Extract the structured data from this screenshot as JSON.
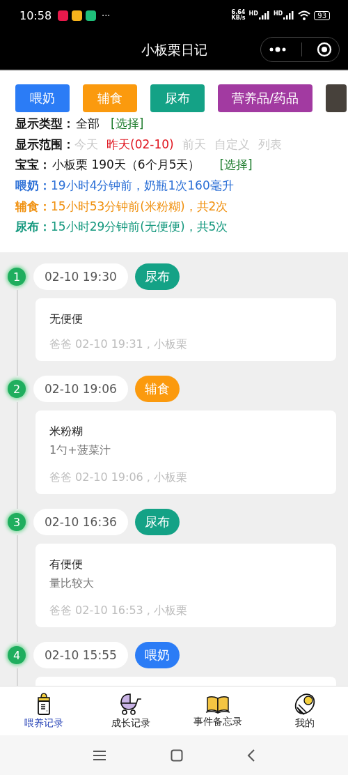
{
  "status_bar": {
    "time": "10:58",
    "more": "···",
    "speed_value": "6.64",
    "speed_unit": "KB/s",
    "sim_labels": [
      "HD",
      "HD"
    ],
    "battery": "93"
  },
  "title_bar": {
    "title": "小板栗日记"
  },
  "categories": [
    {
      "label": "喂奶",
      "color": "#2b7cf6"
    },
    {
      "label": "辅食",
      "color": "#fb9a0e"
    },
    {
      "label": "尿布",
      "color": "#14a286"
    },
    {
      "label": "营养品/药品",
      "color": "#a23aa1"
    },
    {
      "color": "#47413b"
    }
  ],
  "display_type": {
    "label": "显示类型：",
    "value": "全部",
    "action": "[选择]"
  },
  "display_range": {
    "label": "显示范围：",
    "options": [
      {
        "label": "今天",
        "selected": false
      },
      {
        "label": "昨天(02-10)",
        "selected": true
      },
      {
        "label": "前天",
        "selected": false
      },
      {
        "label": "自定义",
        "selected": false
      },
      {
        "label": "列表",
        "selected": false
      }
    ]
  },
  "baby": {
    "label": "宝宝：",
    "value": "小板栗 190天（6个月5天）",
    "action": "[选择]"
  },
  "summaries": [
    {
      "label": "喂奶：",
      "text": "19小时4分钟前，奶瓶1次160毫升",
      "color": "#2b6fd6"
    },
    {
      "label": "辅食：",
      "text": "15小时53分钟前(米粉糊)，共2次",
      "color": "#f0900e"
    },
    {
      "label": "尿布：",
      "text": "15小时29分钟前(无便便)，共5次",
      "color": "#14987e"
    }
  ],
  "entries": [
    {
      "number": "1",
      "time": "02-10 19:30",
      "tag": "尿布",
      "color": "#14a286",
      "title": "无便便",
      "footer": "爸爸 02-10 19:31 , 小板栗"
    },
    {
      "number": "2",
      "time": "02-10 19:06",
      "tag": "辅食",
      "color": "#fb9a0e",
      "title": "米粉糊",
      "note": "1勺+菠菜汁",
      "footer": "爸爸 02-10 19:06 , 小板栗"
    },
    {
      "number": "3",
      "time": "02-10 16:36",
      "tag": "尿布",
      "color": "#14a286",
      "title": "有便便",
      "note": "量比较大",
      "footer": "爸爸 02-10 16:53 , 小板栗"
    },
    {
      "number": "4",
      "time": "02-10 15:55",
      "tag": "喂奶",
      "color": "#2b7cf6"
    }
  ],
  "tab_bar": [
    {
      "label": "喂养记录",
      "kind": "bottle",
      "selected": true
    },
    {
      "label": "成长记录",
      "kind": "stroller",
      "selected": false
    },
    {
      "label": "事件备忘录",
      "kind": "book",
      "selected": false
    },
    {
      "label": "我的",
      "kind": "baby",
      "selected": false
    }
  ]
}
